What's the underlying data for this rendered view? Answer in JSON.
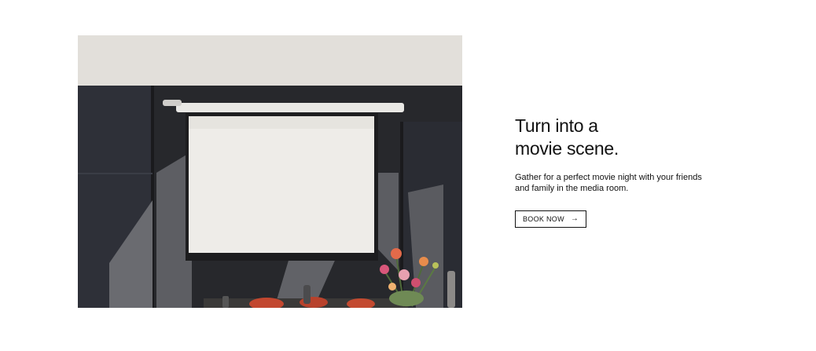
{
  "hero": {
    "heading_line1": "Turn into a",
    "heading_line2": "movie scene.",
    "description_line1": "Gather for a perfect movie night with your friends",
    "description_line2": "and family in the media room.",
    "cta_label": "BOOK NOW",
    "cta_icon": "arrow-right-icon"
  },
  "colors": {
    "text": "#111111",
    "background": "#ffffff",
    "border": "#111111"
  }
}
